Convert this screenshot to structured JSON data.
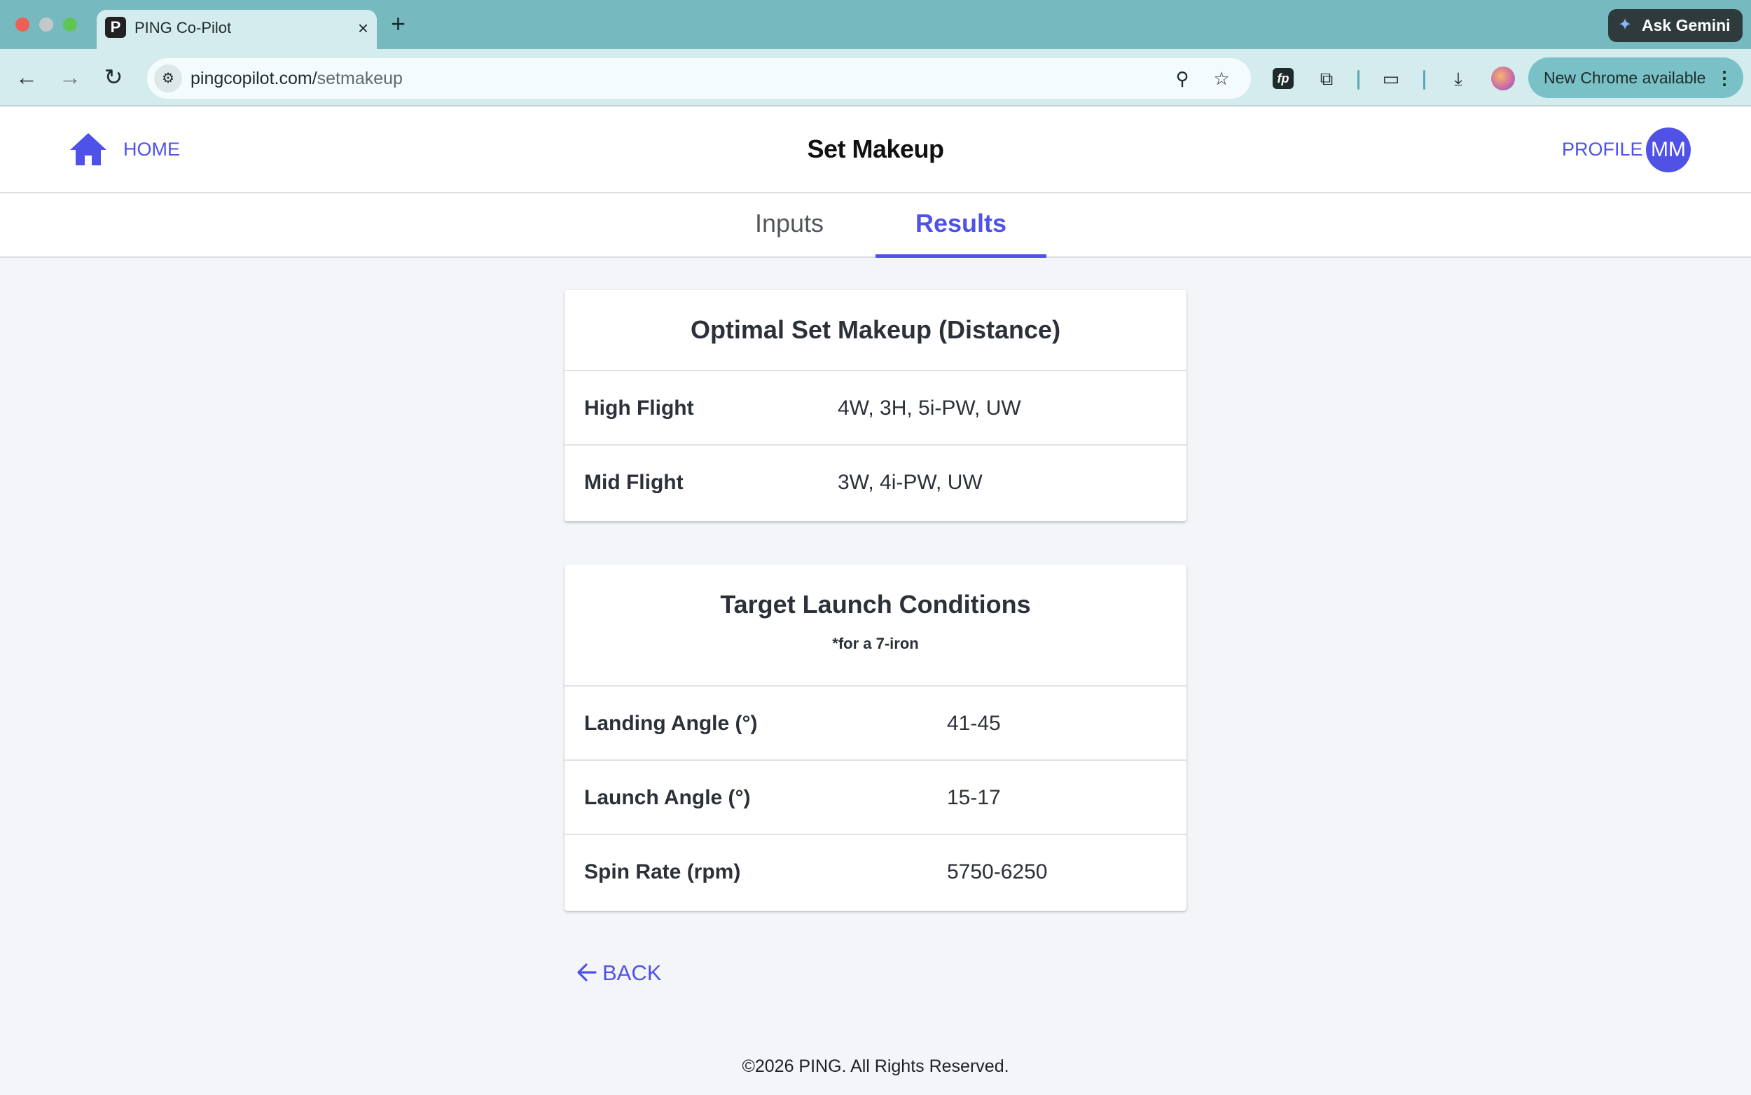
{
  "browser": {
    "tab_title": "PING Co-Pilot",
    "tab_favicon": "P",
    "tab_close": "×",
    "new_tab": "+",
    "gemini_label": "Ask Gemini",
    "url_host": "pingcopilot.com/",
    "url_path": "setmakeup",
    "update_label": "New Chrome available",
    "update_menu": "⋮",
    "icons": [
      "back-icon",
      "forward-icon",
      "reload-icon",
      "site-info-icon",
      "zoom-icon",
      "bookmark-star-icon",
      "extension-fp-icon",
      "extensions-puzzle-icon",
      "cast-icon",
      "download-icon",
      "profile-avatar-icon"
    ]
  },
  "header": {
    "home_label": "HOME",
    "title": "Set Makeup",
    "profile_label": "PROFILE",
    "profile_initials": "MM",
    "accent_color": "#4f52e8"
  },
  "tabs": [
    {
      "label": "Inputs",
      "active": false
    },
    {
      "label": "Results",
      "active": true
    }
  ],
  "set_makeup": {
    "title": "Optimal Set Makeup (Distance)",
    "rows": [
      {
        "label": "High Flight",
        "value": "4W, 3H, 5i-PW, UW"
      },
      {
        "label": "Mid Flight",
        "value": "3W, 4i-PW, UW"
      }
    ]
  },
  "launch_conditions": {
    "title": "Target Launch Conditions",
    "subtitle": "*for a 7-iron",
    "rows": [
      {
        "label": "Landing Angle (°)",
        "value": "41-45"
      },
      {
        "label": "Launch Angle (°)",
        "value": "15-17"
      },
      {
        "label": "Spin Rate (rpm)",
        "value": "5750-6250"
      }
    ]
  },
  "back_label": "BACK",
  "footer": "©2026 PING. All Rights Reserved."
}
